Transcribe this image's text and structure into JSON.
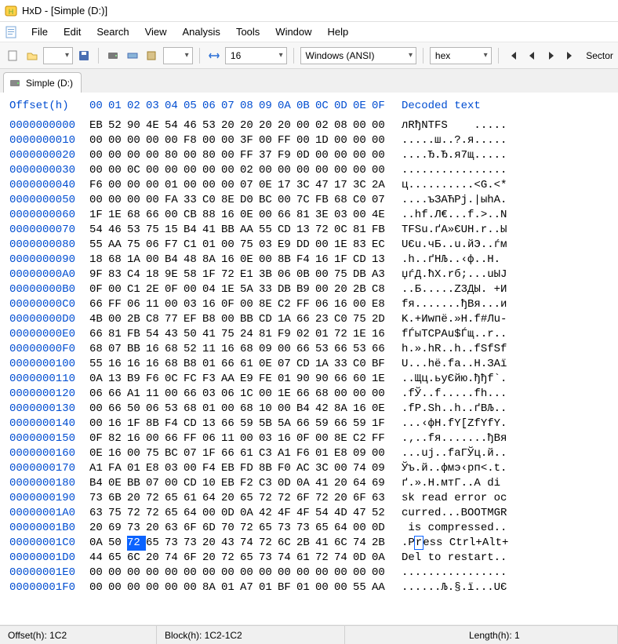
{
  "window": {
    "title": "HxD - [Simple (D:)]"
  },
  "menu": {
    "file": "File",
    "edit": "Edit",
    "search": "Search",
    "view": "View",
    "analysis": "Analysis",
    "tools": "Tools",
    "window": "Window",
    "help": "Help"
  },
  "toolbar": {
    "bytes_per_row": "16",
    "encoding": "Windows (ANSI)",
    "base": "hex",
    "sector_label": "Sector"
  },
  "tab": {
    "label": "Simple (D:)"
  },
  "hex": {
    "header_offset": "Offset(h)",
    "cols": [
      "00",
      "01",
      "02",
      "03",
      "04",
      "05",
      "06",
      "07",
      "08",
      "09",
      "0A",
      "0B",
      "0C",
      "0D",
      "0E",
      "0F"
    ],
    "header_decoded": "Decoded text",
    "selection": {
      "row": 28,
      "col": 2
    },
    "rows": [
      {
        "o": "0000000000",
        "b": [
          "EB",
          "52",
          "90",
          "4E",
          "54",
          "46",
          "53",
          "20",
          "20",
          "20",
          "20",
          "00",
          "02",
          "08",
          "00",
          "00"
        ],
        "d": "лRђNTFS    ....."
      },
      {
        "o": "0000000010",
        "b": [
          "00",
          "00",
          "00",
          "00",
          "00",
          "F8",
          "00",
          "00",
          "3F",
          "00",
          "FF",
          "00",
          "1D",
          "00",
          "00",
          "00"
        ],
        "d": ".....ш..?.я....."
      },
      {
        "o": "0000000020",
        "b": [
          "00",
          "00",
          "00",
          "00",
          "80",
          "00",
          "80",
          "00",
          "FF",
          "37",
          "F9",
          "0D",
          "00",
          "00",
          "00",
          "00"
        ],
        "d": "....Ђ.Ђ.я7щ....."
      },
      {
        "o": "0000000030",
        "b": [
          "00",
          "00",
          "0C",
          "00",
          "00",
          "00",
          "00",
          "00",
          "02",
          "00",
          "00",
          "00",
          "00",
          "00",
          "00",
          "00"
        ],
        "d": "................"
      },
      {
        "o": "0000000040",
        "b": [
          "F6",
          "00",
          "00",
          "00",
          "01",
          "00",
          "00",
          "00",
          "07",
          "0E",
          "17",
          "3C",
          "47",
          "17",
          "3C",
          "2A"
        ],
        "d": "ц..........<G.<*"
      },
      {
        "o": "0000000050",
        "b": [
          "00",
          "00",
          "00",
          "00",
          "FA",
          "33",
          "C0",
          "8E",
          "D0",
          "BC",
          "00",
          "7C",
          "FB",
          "68",
          "C0",
          "07"
        ],
        "d": "....ъЗАЋРј.|ыhА."
      },
      {
        "o": "0000000060",
        "b": [
          "1F",
          "1E",
          "68",
          "66",
          "00",
          "CB",
          "88",
          "16",
          "0E",
          "00",
          "66",
          "81",
          "3E",
          "03",
          "00",
          "4E"
        ],
        "d": "..hf.Л€...f.>..N"
      },
      {
        "o": "0000000070",
        "b": [
          "54",
          "46",
          "53",
          "75",
          "15",
          "B4",
          "41",
          "BB",
          "AA",
          "55",
          "CD",
          "13",
          "72",
          "0C",
          "81",
          "FB"
        ],
        "d": "TFSu.ґA»ЄUН.r..Ы"
      },
      {
        "o": "0000000080",
        "b": [
          "55",
          "AA",
          "75",
          "06",
          "F7",
          "C1",
          "01",
          "00",
          "75",
          "03",
          "E9",
          "DD",
          "00",
          "1E",
          "83",
          "EC"
        ],
        "d": "UЄu.чБ..u.йЭ..ѓм"
      },
      {
        "o": "0000000090",
        "b": [
          "18",
          "68",
          "1A",
          "00",
          "B4",
          "48",
          "8A",
          "16",
          "0E",
          "00",
          "8B",
          "F4",
          "16",
          "1F",
          "CD",
          "13"
        ],
        "d": ".h..ґHЉ..‹ф..Н."
      },
      {
        "o": "00000000A0",
        "b": [
          "9F",
          "83",
          "C4",
          "18",
          "9E",
          "58",
          "1F",
          "72",
          "E1",
          "3B",
          "06",
          "0B",
          "00",
          "75",
          "DB",
          "A3"
        ],
        "d": "џѓД.ћX.rб;...uЫЈ"
      },
      {
        "o": "00000000B0",
        "b": [
          "0F",
          "00",
          "C1",
          "2E",
          "0F",
          "00",
          "04",
          "1E",
          "5A",
          "33",
          "DB",
          "B9",
          "00",
          "20",
          "2B",
          "C8"
        ],
        "d": "..Б.....Z3ДЫ. +И"
      },
      {
        "o": "00000000C0",
        "b": [
          "66",
          "FF",
          "06",
          "11",
          "00",
          "03",
          "16",
          "0F",
          "00",
          "8E",
          "C2",
          "FF",
          "06",
          "16",
          "00",
          "E8"
        ],
        "d": "fя.......ђВя...и"
      },
      {
        "o": "00000000D0",
        "b": [
          "4B",
          "00",
          "2B",
          "C8",
          "77",
          "EF",
          "B8",
          "00",
          "BB",
          "CD",
          "1A",
          "66",
          "23",
          "C0",
          "75",
          "2D"
        ],
        "d": "K.+Иwпё.»Н.f#Лu-"
      },
      {
        "o": "00000000E0",
        "b": [
          "66",
          "81",
          "FB",
          "54",
          "43",
          "50",
          "41",
          "75",
          "24",
          "81",
          "F9",
          "02",
          "01",
          "72",
          "1E",
          "16"
        ],
        "d": "fЃыTCPAu$Ѓщ..r.."
      },
      {
        "o": "00000000F0",
        "b": [
          "68",
          "07",
          "BB",
          "16",
          "68",
          "52",
          "11",
          "16",
          "68",
          "09",
          "00",
          "66",
          "53",
          "66",
          "53",
          "66"
        ],
        "d": "h.».hR..h..fSfSf"
      },
      {
        "o": "0000000100",
        "b": [
          "55",
          "16",
          "16",
          "16",
          "68",
          "B8",
          "01",
          "66",
          "61",
          "0E",
          "07",
          "CD",
          "1A",
          "33",
          "C0",
          "BF"
        ],
        "d": "U...hё.fa..Н.ЗАї"
      },
      {
        "o": "0000000110",
        "b": [
          "0A",
          "13",
          "B9",
          "F6",
          "0C",
          "FC",
          "F3",
          "AA",
          "E9",
          "FE",
          "01",
          "90",
          "90",
          "66",
          "60",
          "1E"
        ],
        "d": "..Щц.ьуЄйю.ђђf`."
      },
      {
        "o": "0000000120",
        "b": [
          "06",
          "66",
          "A1",
          "11",
          "00",
          "66",
          "03",
          "06",
          "1C",
          "00",
          "1E",
          "66",
          "68",
          "00",
          "00",
          "00"
        ],
        "d": ".fЎ..f.....fh..."
      },
      {
        "o": "0000000130",
        "b": [
          "00",
          "66",
          "50",
          "06",
          "53",
          "68",
          "01",
          "00",
          "68",
          "10",
          "00",
          "B4",
          "42",
          "8A",
          "16",
          "0E"
        ],
        "d": ".fP.Sh..h..ґBЉ.."
      },
      {
        "o": "0000000140",
        "b": [
          "00",
          "16",
          "1F",
          "8B",
          "F4",
          "CD",
          "13",
          "66",
          "59",
          "5B",
          "5A",
          "66",
          "59",
          "66",
          "59",
          "1F"
        ],
        "d": "...‹фН.fY[ZfYfY."
      },
      {
        "o": "0000000150",
        "b": [
          "0F",
          "82",
          "16",
          "00",
          "66",
          "FF",
          "06",
          "11",
          "00",
          "03",
          "16",
          "0F",
          "00",
          "8E",
          "C2",
          "FF"
        ],
        "d": ".‚..fя.......ђВя"
      },
      {
        "o": "0000000160",
        "b": [
          "0E",
          "16",
          "00",
          "75",
          "BC",
          "07",
          "1F",
          "66",
          "61",
          "C3",
          "A1",
          "F6",
          "01",
          "E8",
          "09",
          "00"
        ],
        "d": "...uј..faГЎц.й.."
      },
      {
        "o": "0000000170",
        "b": [
          "A1",
          "FA",
          "01",
          "E8",
          "03",
          "00",
          "F4",
          "EB",
          "FD",
          "8B",
          "F0",
          "AC",
          "3C",
          "00",
          "74",
          "09"
        ],
        "d": "Ўъ.й..фмэ‹рп<.t."
      },
      {
        "o": "0000000180",
        "b": [
          "B4",
          "0E",
          "BB",
          "07",
          "00",
          "CD",
          "10",
          "EB",
          "F2",
          "C3",
          "0D",
          "0A",
          "41",
          "20",
          "64",
          "69"
        ],
        "d": "ґ.».Н.мтГ..A di"
      },
      {
        "o": "0000000190",
        "b": [
          "73",
          "6B",
          "20",
          "72",
          "65",
          "61",
          "64",
          "20",
          "65",
          "72",
          "72",
          "6F",
          "72",
          "20",
          "6F",
          "63"
        ],
        "d": "sk read error oc"
      },
      {
        "o": "00000001A0",
        "b": [
          "63",
          "75",
          "72",
          "72",
          "65",
          "64",
          "00",
          "0D",
          "0A",
          "42",
          "4F",
          "4F",
          "54",
          "4D",
          "47",
          "52"
        ],
        "d": "curred...BOOTMGR"
      },
      {
        "o": "00000001B0",
        "b": [
          "20",
          "69",
          "73",
          "20",
          "63",
          "6F",
          "6D",
          "70",
          "72",
          "65",
          "73",
          "73",
          "65",
          "64",
          "00",
          "0D"
        ],
        "d": " is compressed.."
      },
      {
        "o": "00000001C0",
        "b": [
          "0A",
          "50",
          "72",
          "65",
          "73",
          "73",
          "20",
          "43",
          "74",
          "72",
          "6C",
          "2B",
          "41",
          "6C",
          "74",
          "2B"
        ],
        "d": ".Press Ctrl+Alt+"
      },
      {
        "o": "00000001D0",
        "b": [
          "44",
          "65",
          "6C",
          "20",
          "74",
          "6F",
          "20",
          "72",
          "65",
          "73",
          "74",
          "61",
          "72",
          "74",
          "0D",
          "0A"
        ],
        "d": "Del to restart.."
      },
      {
        "o": "00000001E0",
        "b": [
          "00",
          "00",
          "00",
          "00",
          "00",
          "00",
          "00",
          "00",
          "00",
          "00",
          "00",
          "00",
          "00",
          "00",
          "00",
          "00"
        ],
        "d": "................"
      },
      {
        "o": "00000001F0",
        "b": [
          "00",
          "00",
          "00",
          "00",
          "00",
          "00",
          "8A",
          "01",
          "A7",
          "01",
          "BF",
          "01",
          "00",
          "00",
          "55",
          "AA"
        ],
        "d": "......Љ.§.ї...UЄ"
      }
    ]
  },
  "status": {
    "offset": "Offset(h): 1C2",
    "block": "Block(h): 1C2-1C2",
    "length": "Length(h): 1"
  }
}
